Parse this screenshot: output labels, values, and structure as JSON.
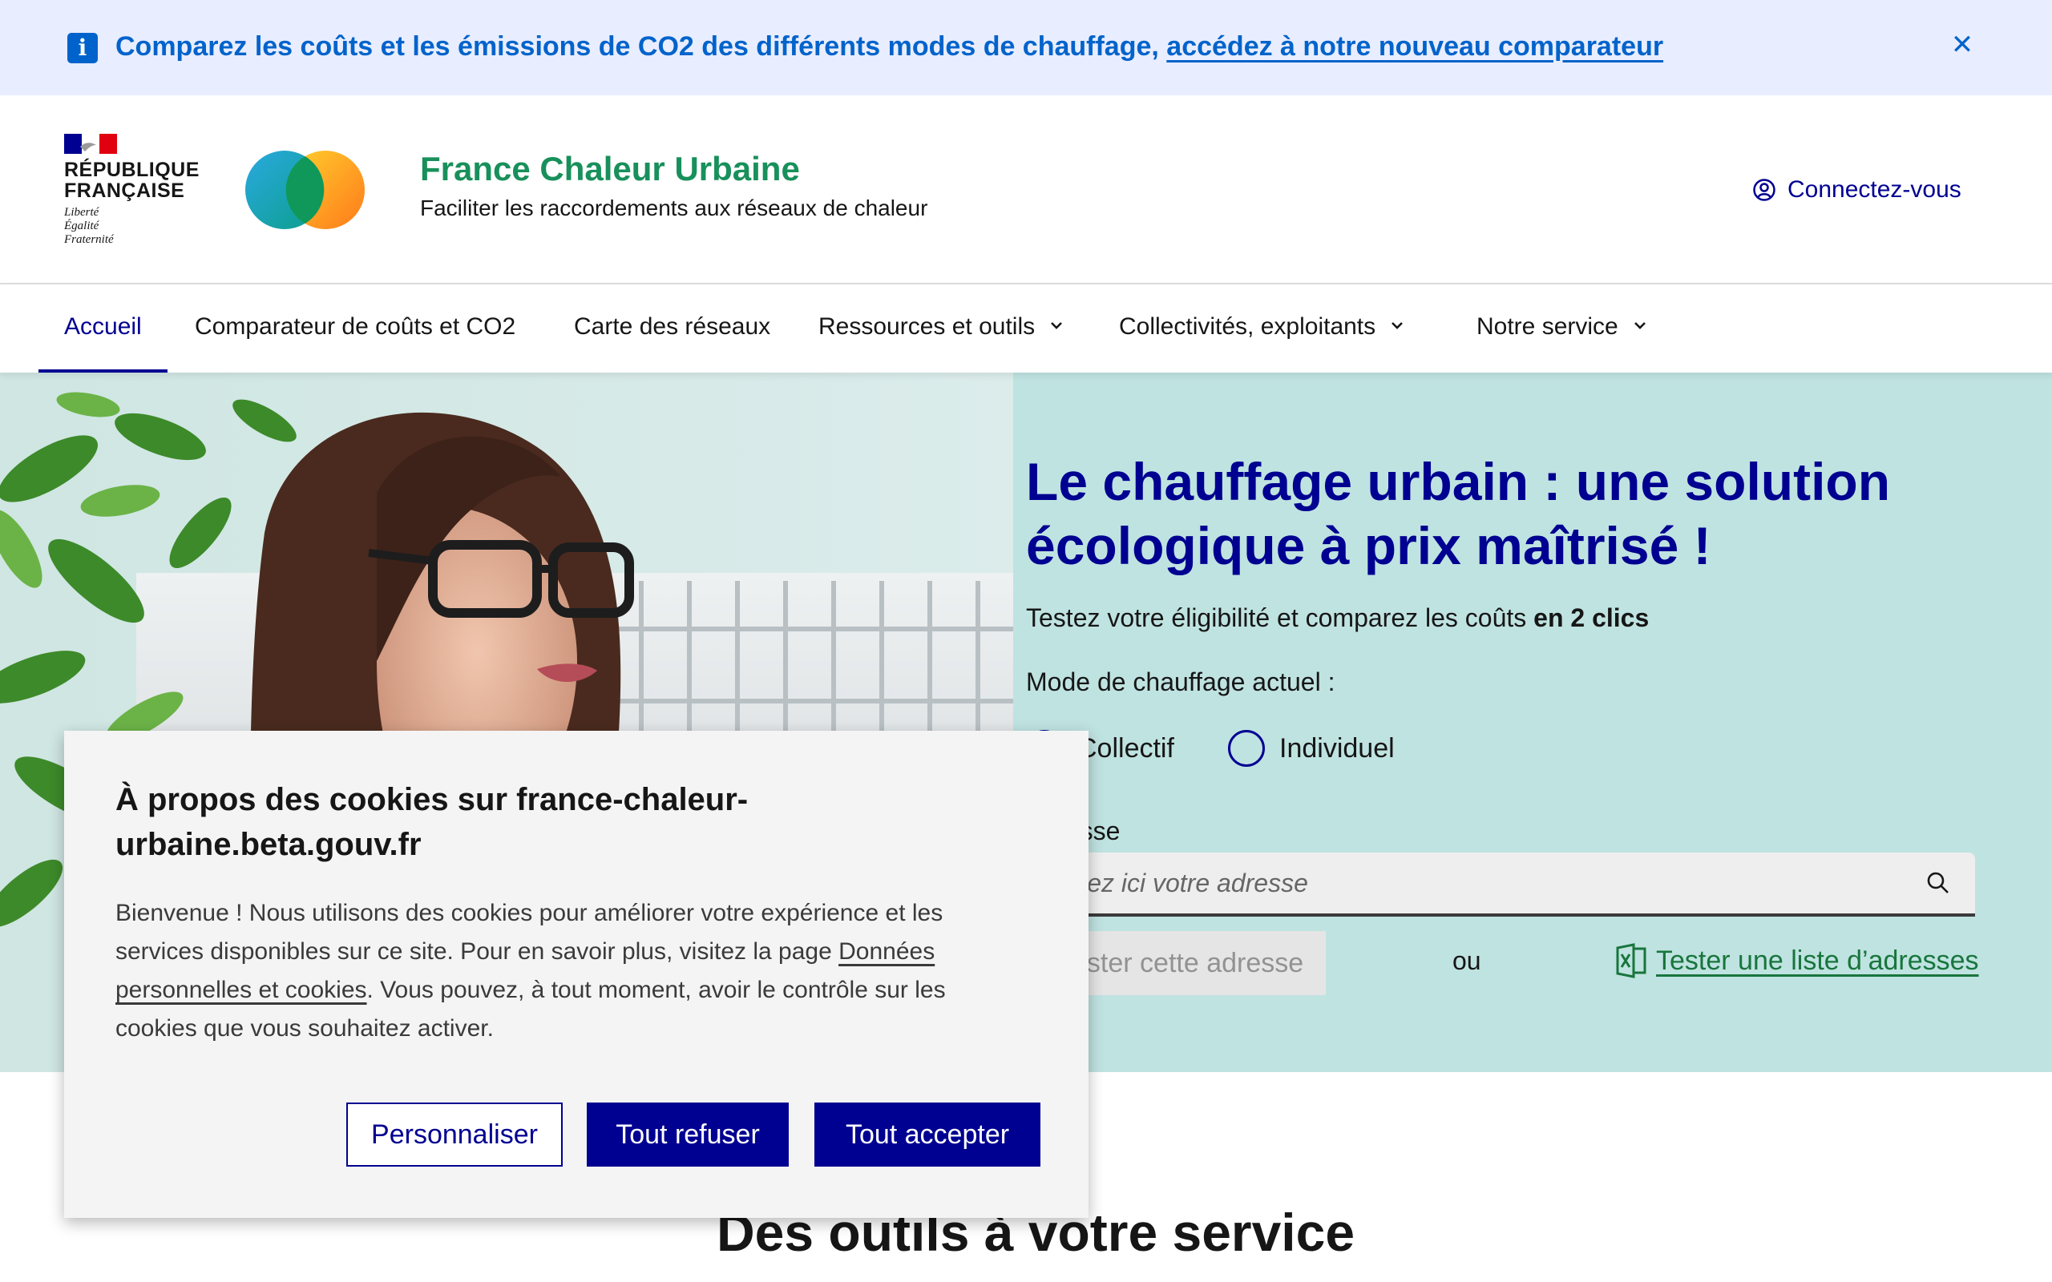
{
  "notice": {
    "text": "Comparez les coûts et les émissions de CO2 des différents modes de chauffage, ",
    "link": "accédez à notre nouveau comparateur",
    "icon": "info-icon",
    "close_icon": "close-icon"
  },
  "header": {
    "republic_line1": "RÉPUBLIQUE",
    "republic_line2": "FRANÇAISE",
    "motto_line1": "Liberté",
    "motto_line2": "Égalité",
    "motto_line3": "Fraternité",
    "site_title": "France Chaleur Urbaine",
    "tagline": "Faciliter les raccordements aux réseaux de chaleur",
    "login_label": "Connectez-vous",
    "login_icon": "user-circle-icon"
  },
  "nav": {
    "items": [
      {
        "label": "Accueil",
        "active": true
      },
      {
        "label": "Comparateur de coûts et CO2"
      },
      {
        "label": "Carte des réseaux"
      },
      {
        "label": "Ressources et outils",
        "dropdown": true
      },
      {
        "label": "Collectivités, exploitants",
        "dropdown": true
      },
      {
        "label": "Notre service",
        "dropdown": true
      }
    ]
  },
  "hero": {
    "title": "Le chauffage urbain : une solution écologique à prix maîtrisé !",
    "subtitle": "Testez votre éligibilité et comparez les coûts ",
    "subtitle_bold": "en 2 clics",
    "mode_label": "Mode de chauffage actuel :",
    "radio_collectif": "Collectif",
    "radio_individuel": "Individuel",
    "address_label": "Adresse",
    "address_placeholder": "Tapez ici votre adresse",
    "test_button": "Tester cette adresse",
    "or": "ou",
    "list_link": "Tester une liste d’adresses"
  },
  "section": {
    "tools_title": "Des outils à votre service"
  },
  "cookie": {
    "title": "À propos des cookies sur france-chaleur-urbaine.beta.gouv.fr",
    "body_start": "Bienvenue ! Nous utilisons des cookies pour améliorer votre expérience et les services disponibles sur ce site. Pour en savoir plus, visitez la page ",
    "body_link": "Données personnelles et cookies",
    "body_end": ".  Vous pouvez, à tout moment, avoir le contrôle sur les cookies que vous souhaitez activer.",
    "btn_customize": "Personnaliser",
    "btn_refuse": "Tout refuser",
    "btn_accept": "Tout accepter"
  },
  "colors": {
    "primary_blue": "#000091",
    "brand_green": "#18905b",
    "notice_bg": "#e8edff",
    "hero_bg": "#bfe3e1"
  }
}
